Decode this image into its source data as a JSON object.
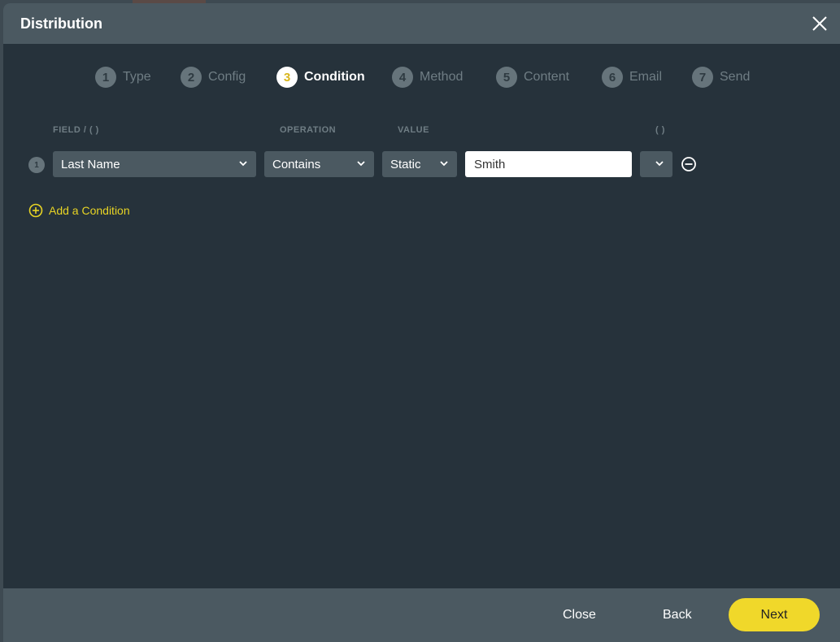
{
  "dialog": {
    "title": "Distribution",
    "close_icon": "close-x-icon"
  },
  "steps": [
    {
      "num": "1",
      "label": "Type",
      "state": "inactive"
    },
    {
      "num": "2",
      "label": "Config",
      "state": "inactive"
    },
    {
      "num": "3",
      "label": "Condition",
      "state": "active"
    },
    {
      "num": "4",
      "label": "Method",
      "state": "inactive"
    },
    {
      "num": "5",
      "label": "Content",
      "state": "inactive"
    },
    {
      "num": "6",
      "label": "Email",
      "state": "inactive"
    },
    {
      "num": "7",
      "label": "Send",
      "state": "inactive"
    }
  ],
  "columns": {
    "field": "FIELD / ( )",
    "operation": "OPERATION",
    "value": "VALUE",
    "paren": "( )"
  },
  "conditions": [
    {
      "index": "1",
      "field": "Last Name",
      "operation": "Contains",
      "value_type": "Static",
      "value": "Smith",
      "paren": ""
    }
  ],
  "add_condition_label": "Add a Condition",
  "footer": {
    "close_label": "Close",
    "back_label": "Back",
    "next_label": "Next"
  },
  "colors": {
    "accent": "#f0d82a",
    "active_step_number": "#d8b51a",
    "header_bg": "#4b5961",
    "body_bg": "#26323b"
  }
}
